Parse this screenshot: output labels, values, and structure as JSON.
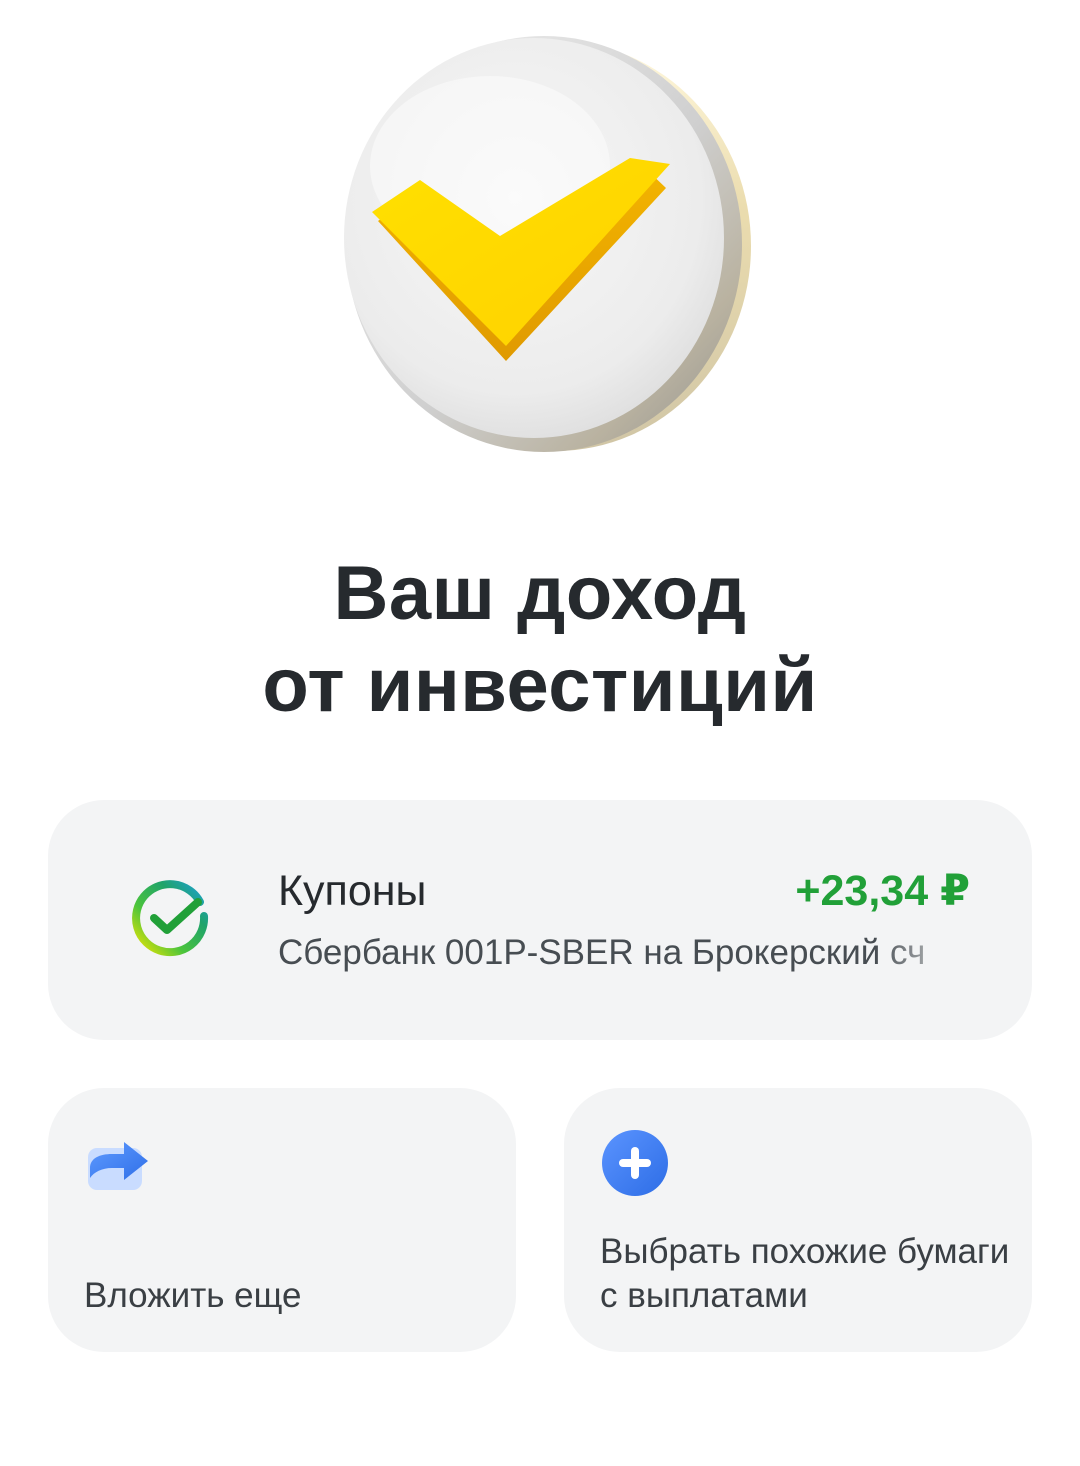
{
  "header": {
    "title_line1": "Ваш доход",
    "title_line2": "от инвестиций"
  },
  "income": {
    "title": "Купоны",
    "amount": "+23,34 ₽",
    "description": "Сбербанк 001P-SBER на Брокерский сч",
    "amount_color": "#21a038",
    "icon": "sber-logo-icon"
  },
  "actions": {
    "invest_more": {
      "label": "Вложить еще",
      "icon": "share-arrow-icon"
    },
    "choose_similar": {
      "label": "Выбрать похожие бумаги с выплатами",
      "icon": "plus-circle-icon"
    }
  },
  "colors": {
    "accent_green": "#21a038",
    "check_yellow": "#ffd600",
    "icon_blue": "#3e7bf0"
  }
}
